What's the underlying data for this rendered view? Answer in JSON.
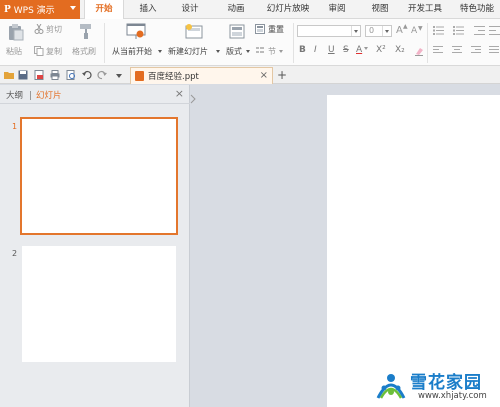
{
  "app": {
    "name": "WPS 演示",
    "logo_letter": "P"
  },
  "menu_tabs": [
    {
      "label": "开始",
      "active": true
    },
    {
      "label": "插入"
    },
    {
      "label": "设计"
    },
    {
      "label": "动画"
    },
    {
      "label": "幻灯片放映"
    },
    {
      "label": "审阅"
    },
    {
      "label": "视图"
    },
    {
      "label": "开发工具"
    },
    {
      "label": "特色功能"
    }
  ],
  "ribbon": {
    "paste": "粘贴",
    "cut": "剪切",
    "copy": "复制",
    "format_painter": "格式刷",
    "from_current": "从当前开始",
    "new_slide": "新建幻灯片",
    "layout": "版式",
    "reset": "重置",
    "section": "节",
    "font_size": "0",
    "grow_font": "A",
    "shrink_font": "A",
    "bold": "B",
    "italic": "I",
    "underline": "U",
    "strike": "S",
    "font_color": "A",
    "superscript": "X²",
    "subscript": "X₂"
  },
  "document_tab": {
    "filename": "百度经验.ppt"
  },
  "left_panel": {
    "outline_tab": "大纲",
    "slides_tab": "幻灯片",
    "slides": [
      {
        "number": "1",
        "selected": true
      },
      {
        "number": "2",
        "selected": false
      }
    ]
  },
  "watermark": {
    "title": "雪花家园",
    "url": "www.xhjaty.com"
  },
  "colors": {
    "accent": "#e36c20",
    "tab_bar": "#f3f3f3",
    "panel": "#e9ebee",
    "canvas": "#d8dce3",
    "watermark": "#1a7dc9"
  },
  "icons": [
    "paste-icon",
    "cut-icon",
    "copy-icon",
    "format-painter-icon",
    "from-current-icon",
    "new-slide-icon",
    "layout-icon",
    "reset-icon",
    "section-icon",
    "open-folder-icon",
    "save-icon",
    "print-icon",
    "undo-icon",
    "redo-icon",
    "close-icon",
    "new-tab-icon",
    "snowflake-logo-icon"
  ]
}
